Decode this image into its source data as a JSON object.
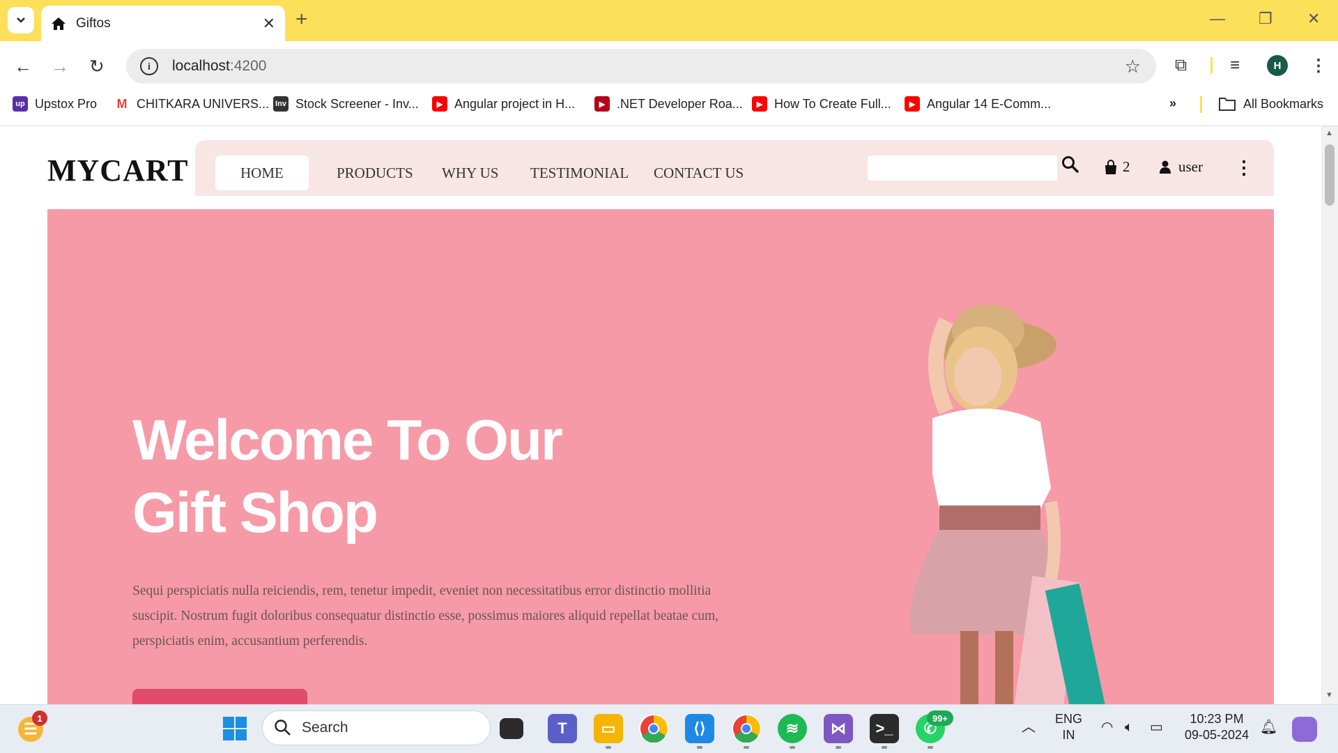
{
  "browser": {
    "tab_title": "Giftos",
    "url_host": "localhost",
    "url_port": ":4200",
    "profile_initial": "H",
    "bookmarks": [
      {
        "label": "Upstox Pro",
        "fav": "up",
        "color": "#5a2ea6"
      },
      {
        "label": "CHITKARA UNIVERS...",
        "fav": "M",
        "color": "#ea4335"
      },
      {
        "label": "Stock Screener - Inv...",
        "fav": "Inv",
        "color": "#333333"
      },
      {
        "label": "Angular project in H...",
        "fav": "▶",
        "color": "#ff0000"
      },
      {
        "label": ".NET Developer Roa...",
        "fav": "▶",
        "color": "#b3001b"
      },
      {
        "label": "How To Create Full...",
        "fav": "▶",
        "color": "#ff0000"
      },
      {
        "label": "Angular 14 E-Comm...",
        "fav": "▶",
        "color": "#ff0000"
      }
    ],
    "all_bookmarks": "All Bookmarks"
  },
  "site": {
    "brand": "MYCART",
    "nav": [
      "HOME",
      "PRODUCTS",
      "WHY US",
      "TESTIMONIAL",
      "CONTACT US"
    ],
    "cart_count": "2",
    "user_label": "user",
    "search_placeholder": ""
  },
  "hero": {
    "title_line1": "Welcome To Our",
    "title_line2": "Gift Shop",
    "text": "Sequi perspiciatis nulla reiciendis, rem, tenetur impedit, eveniet non necessitatibus error distinctio mollitia suscipit. Nostrum fugit doloribus consequatur distinctio esse, possimus maiores aliquid repellat beatae cum, perspiciatis enim, accusantium perferendis.",
    "background": "#f69aa7",
    "button_color": "#e04b6a"
  },
  "taskbar": {
    "search_label": "Search",
    "notification_count": "1",
    "whatsapp_badge": "99+",
    "lang_top": "ENG",
    "lang_bottom": "IN",
    "time": "10:23 PM",
    "date": "09-05-2024"
  }
}
